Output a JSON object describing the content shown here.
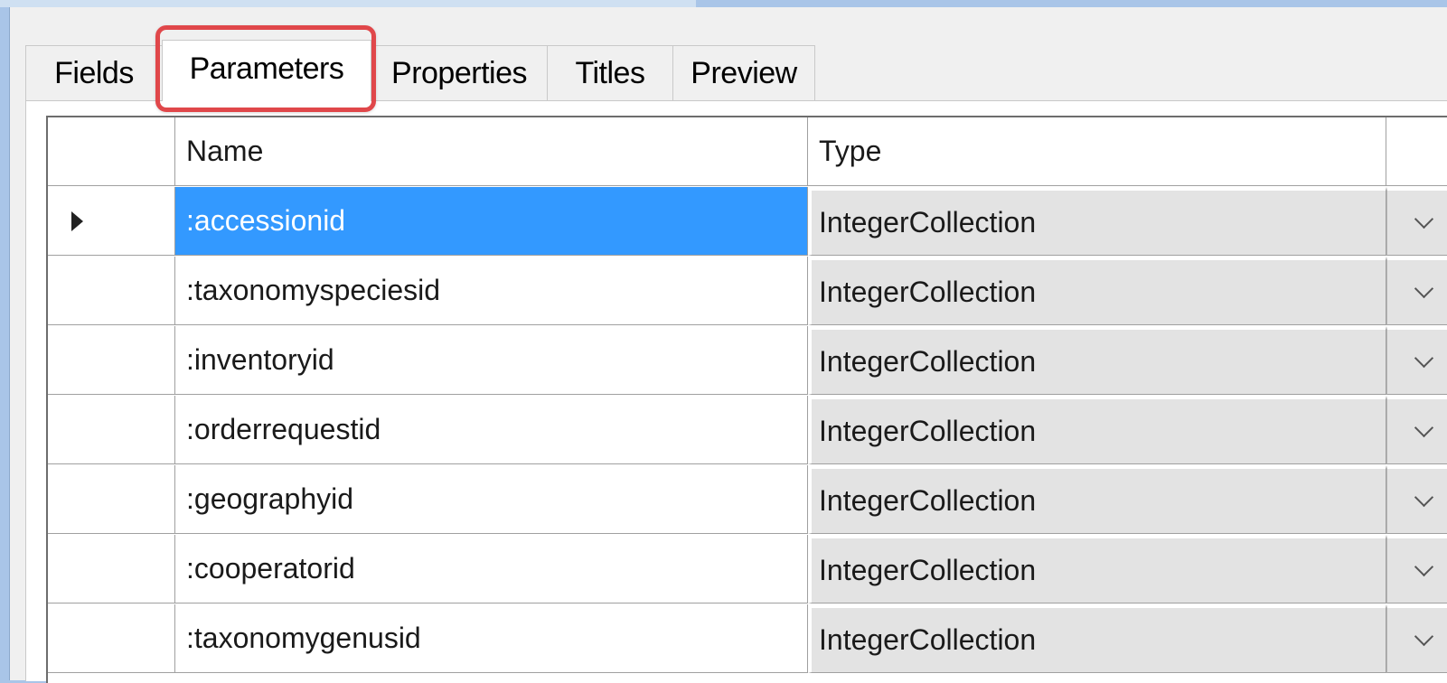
{
  "tabs": [
    {
      "label": "Fields"
    },
    {
      "label": "Parameters"
    },
    {
      "label": "Properties"
    },
    {
      "label": "Titles"
    },
    {
      "label": "Preview"
    }
  ],
  "selected_tab": "Parameters",
  "grid": {
    "columns": [
      "Name",
      "Type"
    ],
    "rows": [
      {
        "name": ":accessionid",
        "type": "IntegerCollection"
      },
      {
        "name": ":taxonomyspeciesid",
        "type": "IntegerCollection"
      },
      {
        "name": ":inventoryid",
        "type": "IntegerCollection"
      },
      {
        "name": ":orderrequestid",
        "type": "IntegerCollection"
      },
      {
        "name": ":geographyid",
        "type": "IntegerCollection"
      },
      {
        "name": ":cooperatorid",
        "type": "IntegerCollection"
      },
      {
        "name": ":taxonomygenusid",
        "type": "IntegerCollection"
      }
    ],
    "selected_row_index": 0
  },
  "colors": {
    "selection": "#3399ff",
    "highlight_box": "#e0474a"
  },
  "icons": {
    "row_indicator": "triangle-right-icon",
    "dropdown": "chevron-down-icon"
  }
}
